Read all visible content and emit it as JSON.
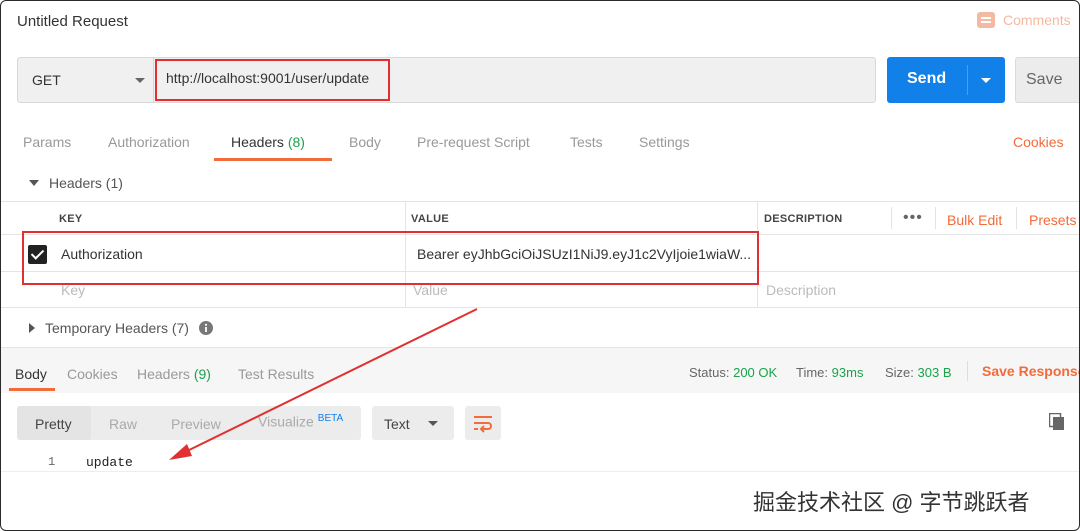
{
  "request": {
    "title": "Untitled Request",
    "comments_label": "Comments",
    "method": "GET",
    "url": "http://localhost:9001/user/update",
    "send_label": "Send",
    "save_label": "Save"
  },
  "request_tabs": [
    {
      "label": "Params"
    },
    {
      "label": "Authorization"
    },
    {
      "label": "Headers",
      "count": "(8)"
    },
    {
      "label": "Body"
    },
    {
      "label": "Pre-request Script"
    },
    {
      "label": "Tests"
    },
    {
      "label": "Settings"
    }
  ],
  "cookies_link": "Cookies",
  "headers": {
    "section_label": "Headers (1)",
    "columns": {
      "key": "KEY",
      "value": "VALUE",
      "description": "DESCRIPTION"
    },
    "more": "•••",
    "bulk_edit": "Bulk Edit",
    "presets": "Presets",
    "rows": [
      {
        "key": "Authorization",
        "value": "Bearer eyJhbGciOiJSUzI1NiJ9.eyJ1c2VyIjoie1wiaW...",
        "description": "",
        "checked": true
      }
    ],
    "placeholder": {
      "key": "Key",
      "value": "Value",
      "description": "Description"
    },
    "temporary_label": "Temporary Headers (7)"
  },
  "response": {
    "tabs": [
      {
        "label": "Body"
      },
      {
        "label": "Cookies"
      },
      {
        "label": "Headers",
        "count": "(9)"
      },
      {
        "label": "Test Results"
      }
    ],
    "status_label": "Status:",
    "status_value": "200 OK",
    "time_label": "Time:",
    "time_value": "93ms",
    "size_label": "Size:",
    "size_value": "303 B",
    "save_response": "Save Response",
    "view_modes": [
      "Pretty",
      "Raw",
      "Preview",
      "Visualize"
    ],
    "beta": "BETA",
    "format": "Text",
    "body_lines": [
      {
        "num": "1",
        "text": "update"
      }
    ]
  },
  "watermark": "掘金技术社区 @ 字节跳跃者",
  "colors": {
    "accent": "#f26b3a",
    "send": "#1180e8",
    "success": "#1aa34a",
    "annotation": "#e03030"
  }
}
